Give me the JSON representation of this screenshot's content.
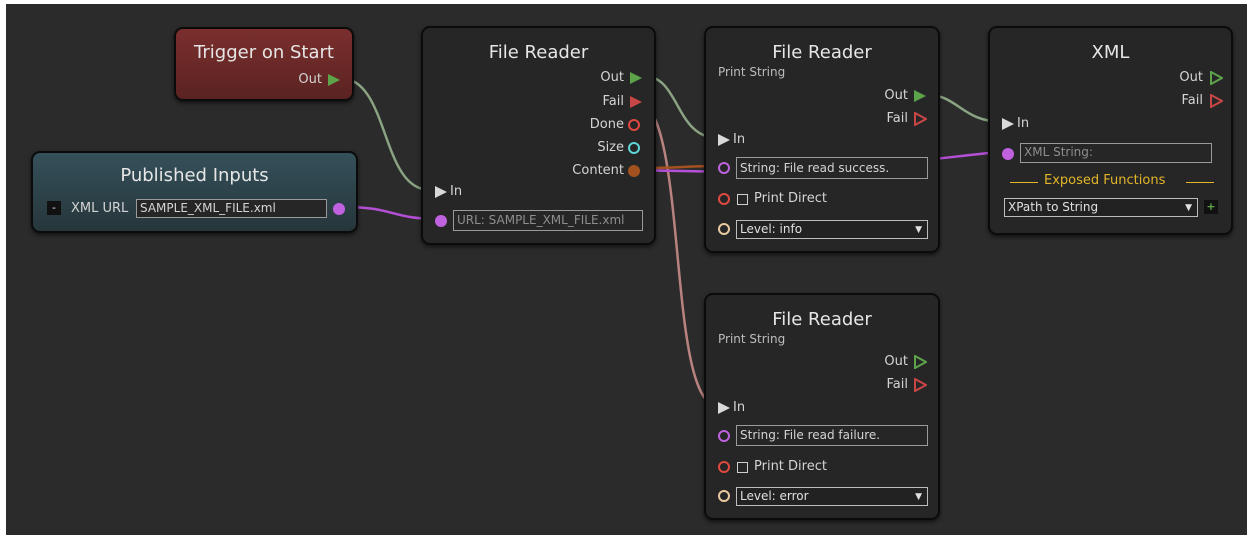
{
  "nodes": {
    "trigger": {
      "title": "Trigger on Start",
      "out_label": "Out"
    },
    "published_inputs": {
      "title": "Published Inputs",
      "collapse_label": "-",
      "xml_url_label": "XML URL",
      "xml_url_value": "SAMPLE_XML_FILE.xml"
    },
    "file_reader_main": {
      "title": "File Reader",
      "outputs": [
        "Out",
        "Fail",
        "Done",
        "Size",
        "Content"
      ],
      "in_label": "In",
      "url_field": "URL: SAMPLE_XML_FILE.xml"
    },
    "print_success": {
      "title": "File Reader",
      "subtitle": "Print String",
      "out_label": "Out",
      "fail_label": "Fail",
      "in_label": "In",
      "string_field": "String: File read success.",
      "print_direct_label": "Print Direct",
      "level_value": "Level: info"
    },
    "print_failure": {
      "title": "File Reader",
      "subtitle": "Print String",
      "out_label": "Out",
      "fail_label": "Fail",
      "in_label": "In",
      "string_field": "String: File read failure.",
      "print_direct_label": "Print Direct",
      "level_value": "Level: error"
    },
    "xml": {
      "title": "XML",
      "out_label": "Out",
      "fail_label": "Fail",
      "in_label": "In",
      "xml_string_field": "XML String:",
      "exposed_functions_label": "Exposed Functions",
      "function_select": "XPath to String",
      "add_label": "+"
    }
  },
  "colors": {
    "canvas": "#2b2b2b",
    "node_body": "#262626",
    "trigger_header": "#6e2a29",
    "inputs_header": "#31474c",
    "flow_out": "#5da34a",
    "flow_fail": "#c84646",
    "flow_in": "#d9d9d9",
    "string_port": "#c062e0",
    "bool_port": "#e0493f",
    "enum_port": "#e8c9a0",
    "size_port": "#5fd6d6",
    "content_port": "#a3521f",
    "exposed_label": "#e3b52a"
  }
}
